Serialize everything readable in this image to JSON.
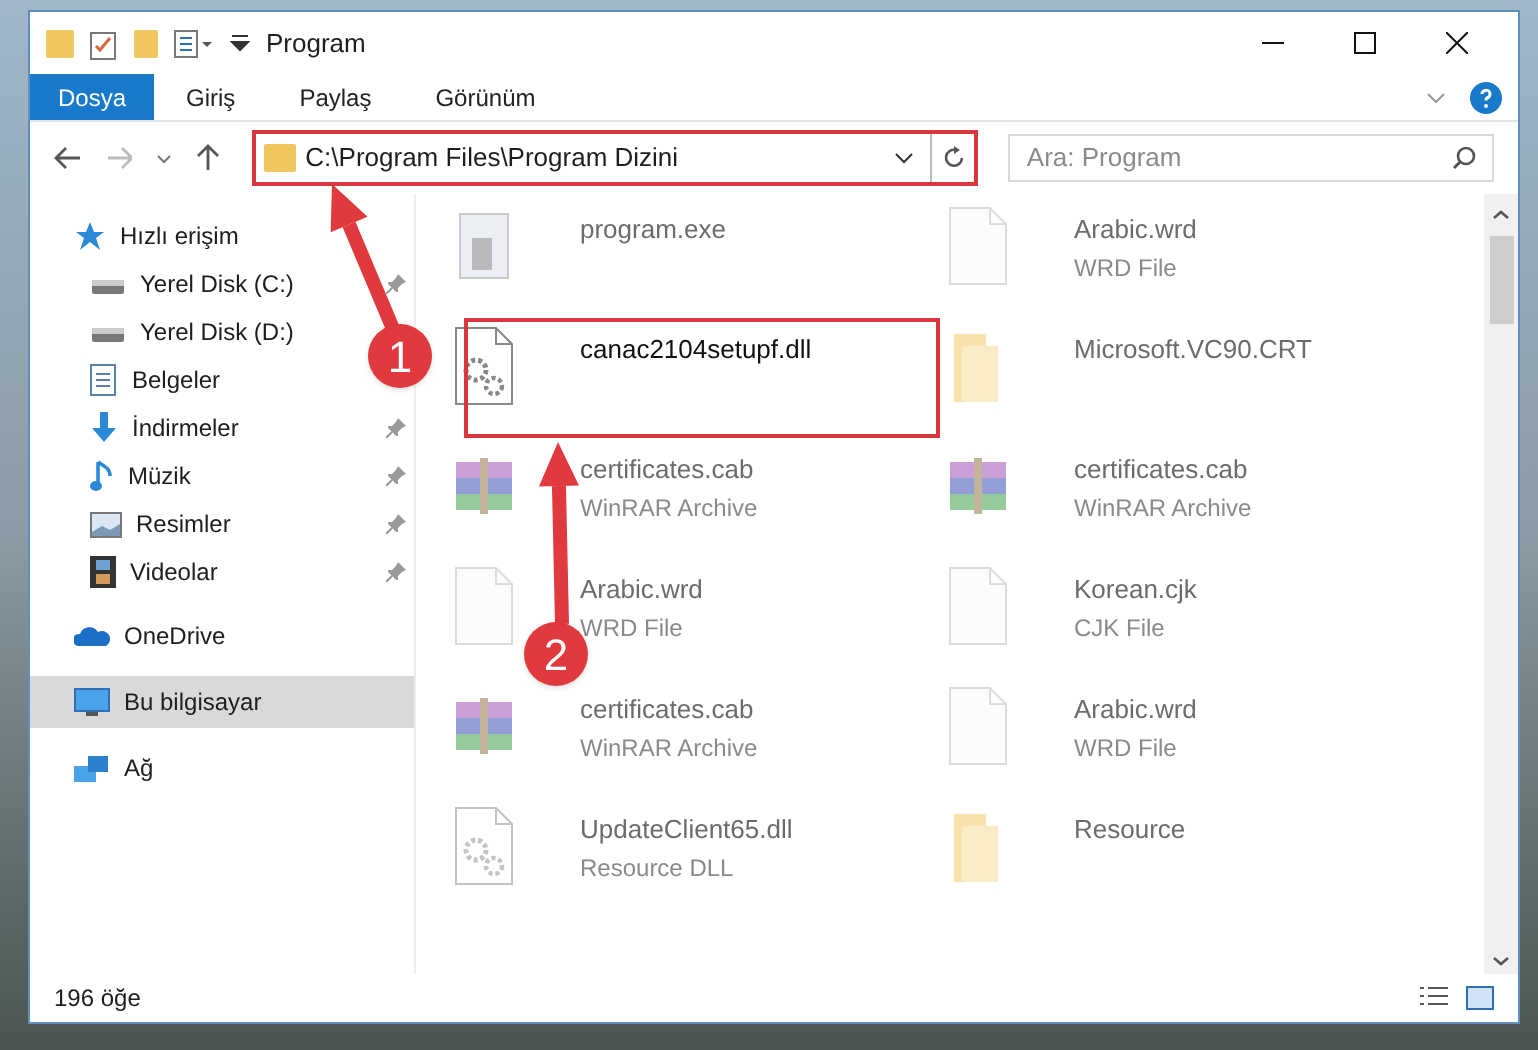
{
  "window": {
    "title": "Program"
  },
  "ribbon_tabs": [
    {
      "label": "Dosya",
      "selected": true
    },
    {
      "label": "Giriş",
      "selected": false
    },
    {
      "label": "Paylaş",
      "selected": false
    },
    {
      "label": "Görünüm",
      "selected": false
    }
  ],
  "address_bar": {
    "path": "C:\\Program Files\\Program Dizini"
  },
  "search": {
    "placeholder": "Ara: Program"
  },
  "sidebar": {
    "items": [
      {
        "label": "Hızlı erişim",
        "kind": "star",
        "selected": false,
        "children": [
          {
            "label": "Yerel Disk (C:)",
            "kind": "drive",
            "pinned": true
          },
          {
            "label": "Yerel Disk (D:)",
            "kind": "drive",
            "pinned": false
          },
          {
            "label": "Belgeler",
            "kind": "document",
            "pinned": false
          },
          {
            "label": "İndirmeler",
            "kind": "download",
            "pinned": true
          },
          {
            "label": "Müzik",
            "kind": "music",
            "pinned": true
          },
          {
            "label": "Resimler",
            "kind": "picture",
            "pinned": true
          },
          {
            "label": "Videolar",
            "kind": "film",
            "pinned": true
          }
        ]
      },
      {
        "label": "OneDrive",
        "kind": "cloud",
        "selected": false
      },
      {
        "label": "Bu bilgisayar",
        "kind": "monitor",
        "selected": true
      },
      {
        "label": "Ağ",
        "kind": "network",
        "selected": false
      }
    ]
  },
  "files": [
    {
      "name": "program.exe",
      "kind": "exe",
      "faded": true
    },
    {
      "name": "Arabic.wrd",
      "type": "WRD File",
      "kind": "blank",
      "faded": true
    },
    {
      "name": "canac2104setupf.dll",
      "kind": "dll",
      "faded": false
    },
    {
      "name": "Microsoft.VC90.CRT",
      "kind": "folder",
      "faded": true
    },
    {
      "name": "certificates.cab",
      "type": "WinRAR Archive",
      "kind": "archive",
      "faded": true
    },
    {
      "name": "certificates.cab",
      "type": "WinRAR Archive",
      "kind": "archive",
      "faded": true
    },
    {
      "name": "Arabic.wrd",
      "type": "WRD File",
      "kind": "blank",
      "faded": true
    },
    {
      "name": "Korean.cjk",
      "type": "CJK File",
      "kind": "blank",
      "faded": true
    },
    {
      "name": "certificates.cab",
      "type": "WinRAR Archive",
      "kind": "archive",
      "faded": true
    },
    {
      "name": "Arabic.wrd",
      "type": "WRD File",
      "kind": "blank",
      "faded": true
    },
    {
      "name": "UpdateClient65.dll",
      "type": "Resource DLL",
      "kind": "dll",
      "faded": true
    },
    {
      "name": "Resource",
      "kind": "folder",
      "faded": true
    }
  ],
  "status_bar": {
    "item_count": "196 öğe"
  },
  "annotations": [
    {
      "number": "1"
    },
    {
      "number": "2"
    }
  ]
}
